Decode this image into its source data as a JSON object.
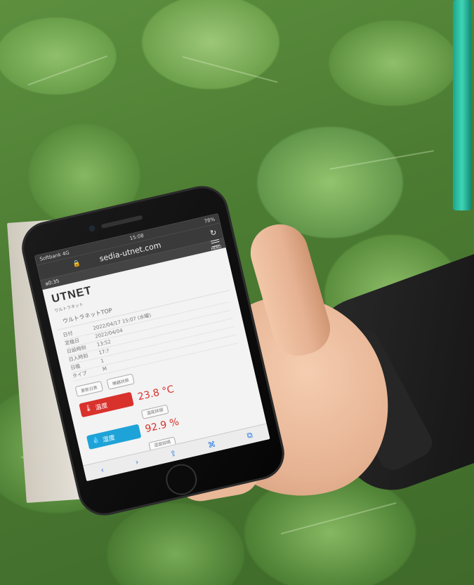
{
  "status": {
    "carrier": "Softbank 4G",
    "time": "15:08",
    "battery": "78%"
  },
  "browser": {
    "url": "sedia-utnet.com",
    "reload_icon": "reload-icon",
    "menu_label": "MENU",
    "strip_left": "a0:35"
  },
  "site": {
    "logo": "UTNET",
    "logo_sub": "ウルトラネット",
    "page_title": "ウルトラネットTOP",
    "info": [
      {
        "key": "日付",
        "value": "2022/04/17 15:07 (水曜)"
      },
      {
        "key": "定植日",
        "value": "2022/04/04"
      },
      {
        "key": "日設時刻",
        "value": "13:52"
      },
      {
        "key": "日入時刻",
        "value": "17:?"
      },
      {
        "key": "日植",
        "value": "1"
      },
      {
        "key": "タイプ",
        "value": "M"
      }
    ],
    "buttons": [
      "更新日表",
      "機器状態"
    ],
    "temperature": {
      "label": "温度",
      "value": "23.8 °C",
      "detail": "温度詳細"
    },
    "humidity": {
      "label": "湿度",
      "value": "92.9 %",
      "detail": "湿度詳細"
    }
  },
  "toolbar": [
    "‹",
    "›",
    "⇪",
    "⌘",
    "⧉"
  ],
  "colors": {
    "temp": "#d9312c",
    "hum": "#1ea3d8",
    "pipe": "#1aa58e"
  }
}
